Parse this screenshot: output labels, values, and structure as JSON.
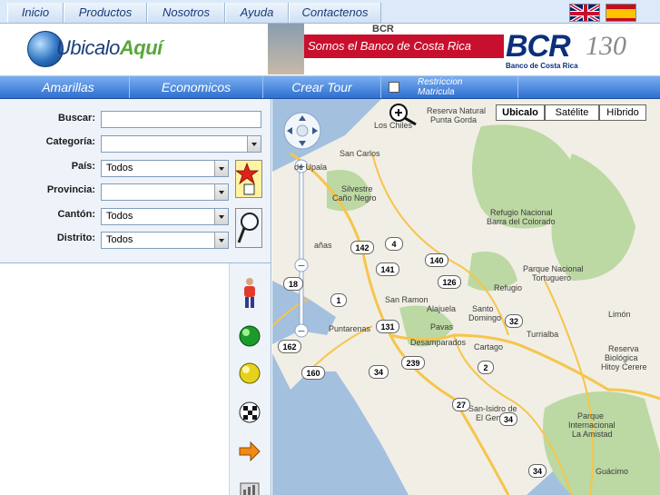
{
  "nav": {
    "items": [
      "Inicio",
      "Productos",
      "Nosotros",
      "Ayuda",
      "Contactenos"
    ]
  },
  "flags": [
    "uk-flag-icon",
    "spain-flag-icon"
  ],
  "logo": {
    "text_main": "Ubicalo",
    "text_accent": "Aquí"
  },
  "ad": {
    "top": "BCR",
    "slogan": "Somos el Banco de Costa Rica",
    "brand": "BCR",
    "brand_sub": "Banco de Costa Rica",
    "anniversary": "130"
  },
  "subnav": {
    "items": [
      "Amarillas",
      "Economicos",
      "Crear Tour"
    ],
    "restriction_label": "Restriccion Matricula"
  },
  "form": {
    "buscar_label": "Buscar:",
    "categoria_label": "Categoría:",
    "pais_label": "País:",
    "pais_value": "Todos",
    "provincia_label": "Provincia:",
    "canton_label": "Cantón:",
    "canton_value": "Todos",
    "distrito_label": "Distrito:",
    "distrito_value": "Todos"
  },
  "map": {
    "types": [
      "Ubicalo",
      "Satélite",
      "Híbrido"
    ],
    "active_type": "Ubicalo",
    "places": [
      "Reserva Natural",
      "Punta Gorda",
      "Los Chiles",
      "San Carlos",
      "de Upala",
      "Silvestre",
      "Caño Negro",
      "Refugio Nacional",
      "Barra del Colorado",
      "Parque Nacional",
      "Tortuguero",
      "Refugio",
      "San Ramon",
      "Alajuela",
      "Santo",
      "Domingo",
      "Pavas",
      "Puntarenas",
      "Desamparados",
      "Cartago",
      "Turrialba",
      "Limón",
      "Reserva",
      "Biológica",
      "Hitoy Cerere",
      "San-Isidro de",
      "El General",
      "Parque",
      "Internacional",
      "La Amistad",
      "Guácimo",
      "añas"
    ],
    "routes": [
      "142",
      "4",
      "141",
      "140",
      "18",
      "126",
      "1",
      "131",
      "32",
      "162",
      "239",
      "34",
      "2",
      "160",
      "27",
      "34",
      "34"
    ]
  },
  "colors": {
    "nav_bg": "#dce9f8",
    "subnav_blue": "#2e6fd0",
    "ad_red": "#c8102e",
    "bcr_blue": "#0b2f7a",
    "map_water": "#a4c0df",
    "map_land": "#f1eee5",
    "map_forest": "#bcd8a3",
    "map_road": "#f6c54a"
  }
}
